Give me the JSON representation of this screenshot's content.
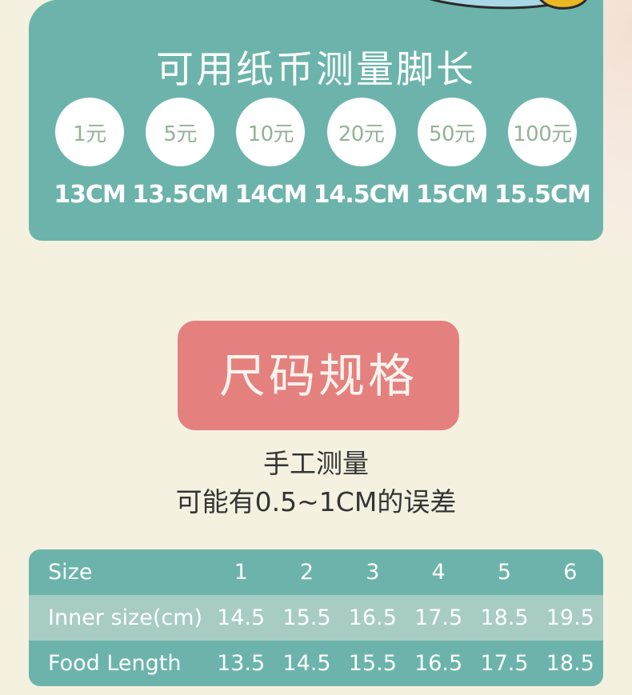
{
  "colors": {
    "page_background": "#F4F1E0",
    "teal": "#6CB4AB",
    "teal_light": "#A7CCC4",
    "pink": "#E4817F",
    "circle_text": "#93B396",
    "note_text": "#343434",
    "white": "#FFFFFF"
  },
  "measure_panel": {
    "title": "可用纸币测量脚长",
    "bills": [
      {
        "denomination": "1元",
        "length": "13CM"
      },
      {
        "denomination": "5元",
        "length": "13.5CM"
      },
      {
        "denomination": "10元",
        "length": "14CM"
      },
      {
        "denomination": "20元",
        "length": "14.5CM"
      },
      {
        "denomination": "50元",
        "length": "15CM"
      },
      {
        "denomination": "100元",
        "length": "15.5CM"
      }
    ]
  },
  "spec_section": {
    "banner_label": "尺码规格",
    "note_line1": "手工测量",
    "note_line2": "可能有0.5~1CM的误差"
  },
  "size_table": {
    "rows": [
      {
        "label": "Size",
        "values": [
          "1",
          "2",
          "3",
          "4",
          "5",
          "6"
        ],
        "style": "dark"
      },
      {
        "label": "Inner size(cm)",
        "values": [
          "14.5",
          "15.5",
          "16.5",
          "17.5",
          "18.5",
          "19.5"
        ],
        "style": "light"
      },
      {
        "label": "Food Length",
        "values": [
          "13.5",
          "14.5",
          "15.5",
          "16.5",
          "17.5",
          "18.5"
        ],
        "style": "dark"
      }
    ]
  }
}
